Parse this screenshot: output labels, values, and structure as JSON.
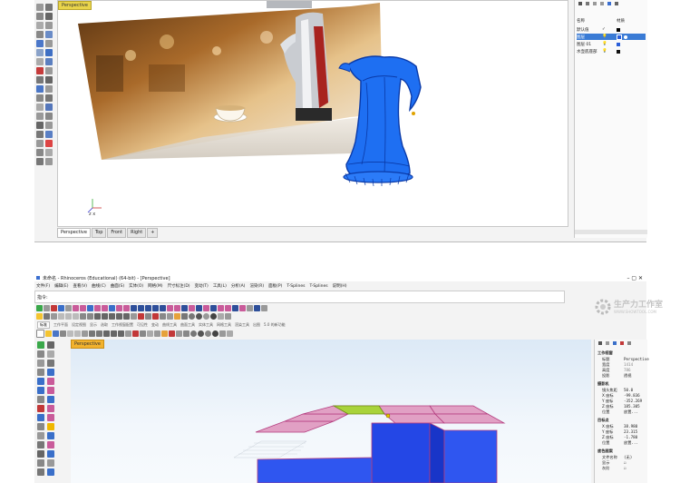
{
  "top_window": {
    "viewport_tab": "Perspective",
    "view_tabs": [
      "Perspective",
      "Top",
      "Front",
      "Right"
    ],
    "add_tab": "+",
    "layers_panel": {
      "col_name": "名称",
      "col_material": "材质",
      "layers": [
        {
          "name": "默认值",
          "check": "✓",
          "color": "#000000"
        },
        {
          "name": "图层",
          "check": "",
          "color": "#2b5fd9",
          "selected": true
        },
        {
          "name": "图层 01",
          "check": "",
          "color": "#2b5fd9"
        },
        {
          "name": "水壶底座部",
          "check": "",
          "color": "#111111"
        }
      ]
    },
    "axis_label": "z  x"
  },
  "bottom_window": {
    "title": "未命名 - Rhinoceros (Educational) (64-bit) - [Perspective]",
    "menu": [
      "文件(F)",
      "编辑(E)",
      "查看(V)",
      "曲线(C)",
      "曲面(S)",
      "实体(O)",
      "网格(M)",
      "尺寸标注(D)",
      "变动(T)",
      "工具(L)",
      "分析(A)",
      "渲染(R)",
      "面板(P)",
      "T-Splines",
      "T-Splines",
      "说明(H)"
    ],
    "command_label": "指令:",
    "toolbar_tabs": [
      "标准",
      "工作平面",
      "设定视图",
      "显示",
      "选取",
      "工作视窗配置",
      "可见性",
      "变动",
      "曲线工具",
      "曲面工具",
      "实体工具",
      "网格工具",
      "渲染工具",
      "出图",
      "5.0 的新功能"
    ],
    "viewport_tab": "Perspective",
    "watermark": {
      "logo": "生产力工作室",
      "url": "WWW.SHOWTOOL.COM"
    },
    "properties": {
      "section1": "工作视窗",
      "rows1": [
        {
          "label": "标题",
          "value": "Perspective"
        },
        {
          "label": "宽度",
          "value": "1414"
        },
        {
          "label": "高度",
          "value": "786"
        },
        {
          "label": "投影",
          "value": "透视"
        }
      ],
      "section2": "摄影机",
      "rows2": [
        {
          "label": "镜头焦距",
          "value": "50.0"
        },
        {
          "label": "X 座标",
          "value": "-99.836"
        },
        {
          "label": "Y 座标",
          "value": "-352.269"
        },
        {
          "label": "Z 座标",
          "value": "185.305"
        },
        {
          "label": "位置",
          "value": "放置..."
        }
      ],
      "section3": "目标点",
      "rows3": [
        {
          "label": "X 座标",
          "value": "38.980"
        },
        {
          "label": "Y 座标",
          "value": "23.315"
        },
        {
          "label": "Z 座标",
          "value": "-1.780"
        },
        {
          "label": "位置",
          "value": "放置..."
        }
      ],
      "section4": "底色图案",
      "rows4": [
        {
          "label": "文件名称",
          "value": "(无)"
        },
        {
          "label": "显示",
          "value": "☑"
        },
        {
          "label": "灰阶",
          "value": "☑"
        }
      ]
    }
  }
}
